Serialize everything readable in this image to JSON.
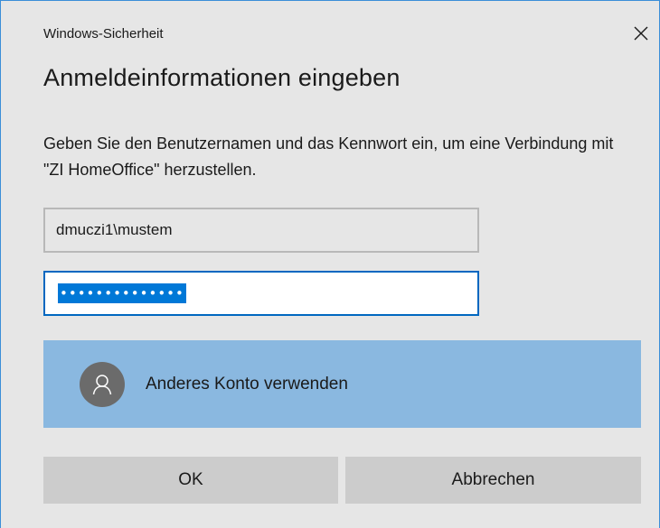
{
  "window": {
    "title": "Windows-Sicherheit",
    "close_icon": "close-icon"
  },
  "dialog": {
    "heading": "Anmeldeinformationen eingeben",
    "description": "Geben Sie den Benutzernamen und das Kennwort ein, um eine Verbindung mit \"ZI HomeOffice\" herzustellen."
  },
  "username": {
    "value": "dmuczi1\\mustem"
  },
  "password": {
    "masked_value": "••••••••••••••",
    "selected": true
  },
  "other_account": {
    "label": "Anderes Konto verwenden",
    "icon": "user-icon"
  },
  "buttons": {
    "ok_label": "OK",
    "cancel_label": "Abbrechen"
  },
  "colors": {
    "dialog_background": "#e6e6e6",
    "accent_border": "#0067c0",
    "selection": "#0078d7",
    "other_account_background": "#8ab8e0",
    "button_background": "#cccccc"
  }
}
